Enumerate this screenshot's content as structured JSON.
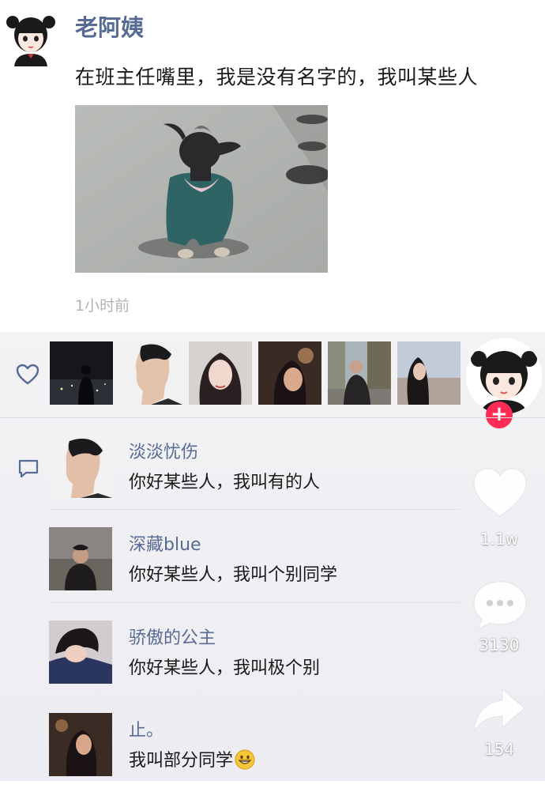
{
  "post": {
    "author": "老阿姨",
    "text": "在班主任嘴里，我是没有名字的，我叫某些人",
    "time": "1小时前"
  },
  "comments": [
    {
      "name": "淡淡忧伤",
      "text": "你好某些人，我叫有的人"
    },
    {
      "name": "深藏blue",
      "text": "你好某些人，我叫个别同学"
    },
    {
      "name": "骄傲的公主",
      "text": "你好某些人，我叫极个别"
    },
    {
      "name": "止。",
      "text": "我叫部分同学"
    }
  ],
  "side_actions": {
    "like_count": "1.1w",
    "comment_count": "3130",
    "share_count": "154",
    "follow_symbol": "+"
  },
  "icons": {
    "heart": "heart-icon",
    "comment": "comment-icon",
    "share": "share-icon",
    "emoji": "grin-emoji-icon"
  },
  "colors": {
    "name_blue": "#576b95",
    "follow_red": "#fe2c55",
    "time_gray": "#b2b2b2"
  }
}
